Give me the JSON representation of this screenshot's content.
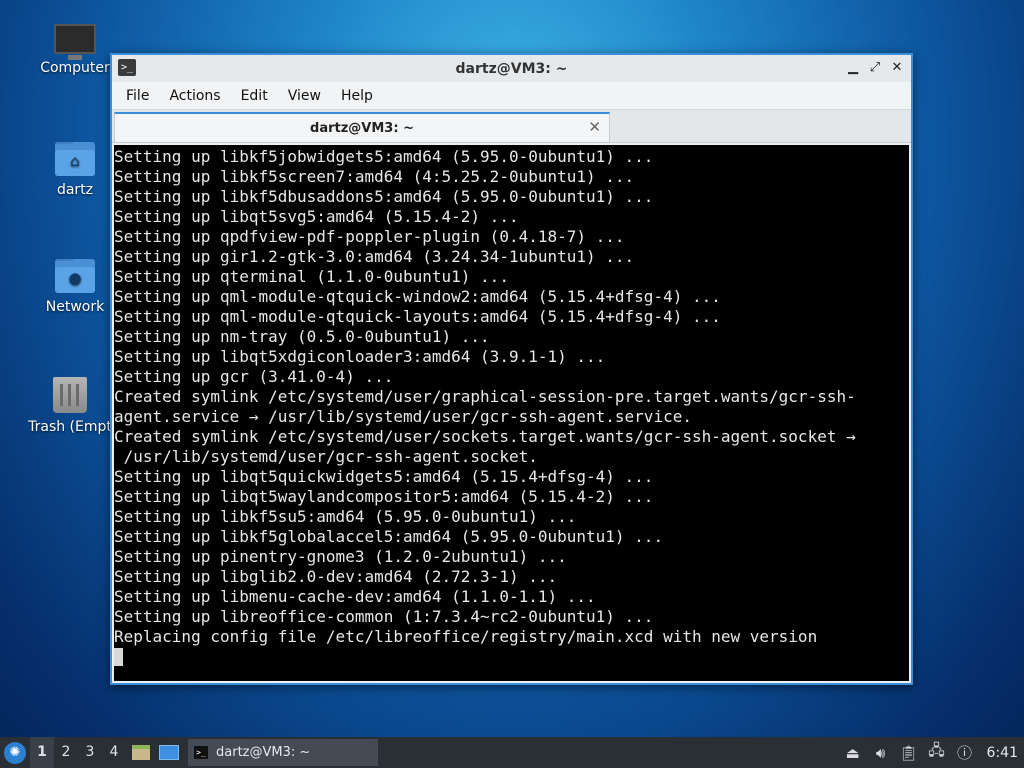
{
  "desktop": {
    "icons": [
      {
        "label": "Computer",
        "icon": "computer-icon"
      },
      {
        "label": "dartz",
        "icon": "home-folder-icon"
      },
      {
        "label": "Network",
        "icon": "network-folder-icon"
      },
      {
        "label": "Trash (Empt",
        "icon": "trash-icon"
      }
    ]
  },
  "window": {
    "title": "dartz@VM3: ~",
    "buttons": {
      "minimize": "▁",
      "maximize": "⤢",
      "close": "✕"
    },
    "menu": [
      "File",
      "Actions",
      "Edit",
      "View",
      "Help"
    ],
    "tab": {
      "label": "dartz@VM3: ~",
      "close": "✕"
    },
    "terminal_lines": [
      "Setting up libkf5jobwidgets5:amd64 (5.95.0-0ubuntu1) ...",
      "Setting up libkf5screen7:amd64 (4:5.25.2-0ubuntu1) ...",
      "Setting up libkf5dbusaddons5:amd64 (5.95.0-0ubuntu1) ...",
      "Setting up libqt5svg5:amd64 (5.15.4-2) ...",
      "Setting up qpdfview-pdf-poppler-plugin (0.4.18-7) ...",
      "Setting up gir1.2-gtk-3.0:amd64 (3.24.34-1ubuntu1) ...",
      "Setting up qterminal (1.1.0-0ubuntu1) ...",
      "Setting up qml-module-qtquick-window2:amd64 (5.15.4+dfsg-4) ...",
      "Setting up qml-module-qtquick-layouts:amd64 (5.15.4+dfsg-4) ...",
      "Setting up nm-tray (0.5.0-0ubuntu1) ...",
      "Setting up libqt5xdgiconloader3:amd64 (3.9.1-1) ...",
      "Setting up gcr (3.41.0-4) ...",
      "Created symlink /etc/systemd/user/graphical-session-pre.target.wants/gcr-ssh-",
      "agent.service → /usr/lib/systemd/user/gcr-ssh-agent.service.",
      "Created symlink /etc/systemd/user/sockets.target.wants/gcr-ssh-agent.socket →",
      " /usr/lib/systemd/user/gcr-ssh-agent.socket.",
      "Setting up libqt5quickwidgets5:amd64 (5.15.4+dfsg-4) ...",
      "Setting up libqt5waylandcompositor5:amd64 (5.15.4-2) ...",
      "Setting up libkf5su5:amd64 (5.95.0-0ubuntu1) ...",
      "Setting up libkf5globalaccel5:amd64 (5.95.0-0ubuntu1) ...",
      "Setting up pinentry-gnome3 (1.2.0-2ubuntu1) ...",
      "Setting up libglib2.0-dev:amd64 (2.72.3-1) ...",
      "Setting up libmenu-cache-dev:amd64 (1.1.0-1.1) ...",
      "Setting up libreoffice-common (1:7.3.4~rc2-0ubuntu1) ...",
      "Replacing config file /etc/libreoffice/registry/main.xcd with new version"
    ]
  },
  "taskbar": {
    "workspaces": [
      "1",
      "2",
      "3",
      "4"
    ],
    "active_workspace": "1",
    "task_label": "dartz@VM3: ~",
    "clock": "6:41",
    "tray_icons": [
      "eject-icon",
      "volume-icon",
      "clipboard-icon",
      "network-icon",
      "notification-icon"
    ]
  },
  "colors": {
    "accent": "#3a8fd8",
    "terminal_bg": "#000000",
    "taskbar_bg": "#2a2f36"
  }
}
